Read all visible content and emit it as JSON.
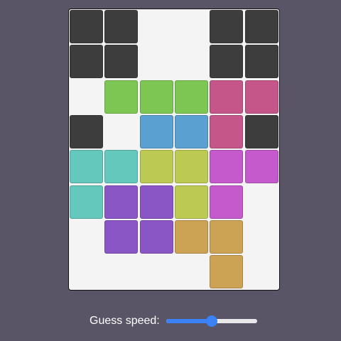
{
  "colors": {
    "background": "#595566",
    "board": "#f4f4f4",
    "dark": "#3d3d3d",
    "green": "#7ec654",
    "pink": "#c4568a",
    "blue": "#5aa0d0",
    "teal": "#64c8bc",
    "olive": "#bcca54",
    "magenta": "#c45acc",
    "purple": "#8a56c6",
    "gold": "#cca255"
  },
  "board": {
    "columns": 6,
    "rows": 8,
    "cells": [
      {
        "row": 0,
        "col": 0,
        "color": "dark"
      },
      {
        "row": 0,
        "col": 1,
        "color": "dark"
      },
      {
        "row": 0,
        "col": 4,
        "color": "dark"
      },
      {
        "row": 0,
        "col": 5,
        "color": "dark"
      },
      {
        "row": 1,
        "col": 0,
        "color": "dark"
      },
      {
        "row": 1,
        "col": 1,
        "color": "dark"
      },
      {
        "row": 1,
        "col": 4,
        "color": "dark"
      },
      {
        "row": 1,
        "col": 5,
        "color": "dark"
      },
      {
        "row": 2,
        "col": 1,
        "color": "green"
      },
      {
        "row": 2,
        "col": 2,
        "color": "green"
      },
      {
        "row": 2,
        "col": 3,
        "color": "green"
      },
      {
        "row": 2,
        "col": 4,
        "color": "pink"
      },
      {
        "row": 2,
        "col": 5,
        "color": "pink"
      },
      {
        "row": 3,
        "col": 0,
        "color": "dark"
      },
      {
        "row": 3,
        "col": 2,
        "color": "blue"
      },
      {
        "row": 3,
        "col": 3,
        "color": "blue"
      },
      {
        "row": 3,
        "col": 4,
        "color": "pink"
      },
      {
        "row": 3,
        "col": 5,
        "color": "dark"
      },
      {
        "row": 4,
        "col": 0,
        "color": "teal"
      },
      {
        "row": 4,
        "col": 1,
        "color": "teal"
      },
      {
        "row": 4,
        "col": 2,
        "color": "olive"
      },
      {
        "row": 4,
        "col": 3,
        "color": "olive"
      },
      {
        "row": 4,
        "col": 4,
        "color": "magenta"
      },
      {
        "row": 4,
        "col": 5,
        "color": "magenta"
      },
      {
        "row": 5,
        "col": 0,
        "color": "teal"
      },
      {
        "row": 5,
        "col": 1,
        "color": "purple"
      },
      {
        "row": 5,
        "col": 2,
        "color": "purple"
      },
      {
        "row": 5,
        "col": 3,
        "color": "olive"
      },
      {
        "row": 5,
        "col": 4,
        "color": "magenta"
      },
      {
        "row": 6,
        "col": 1,
        "color": "purple"
      },
      {
        "row": 6,
        "col": 2,
        "color": "purple"
      },
      {
        "row": 6,
        "col": 3,
        "color": "gold"
      },
      {
        "row": 6,
        "col": 4,
        "color": "gold"
      },
      {
        "row": 7,
        "col": 4,
        "color": "gold"
      }
    ]
  },
  "controls": {
    "speed_label": "Guess speed:",
    "speed_value": 0.5
  }
}
